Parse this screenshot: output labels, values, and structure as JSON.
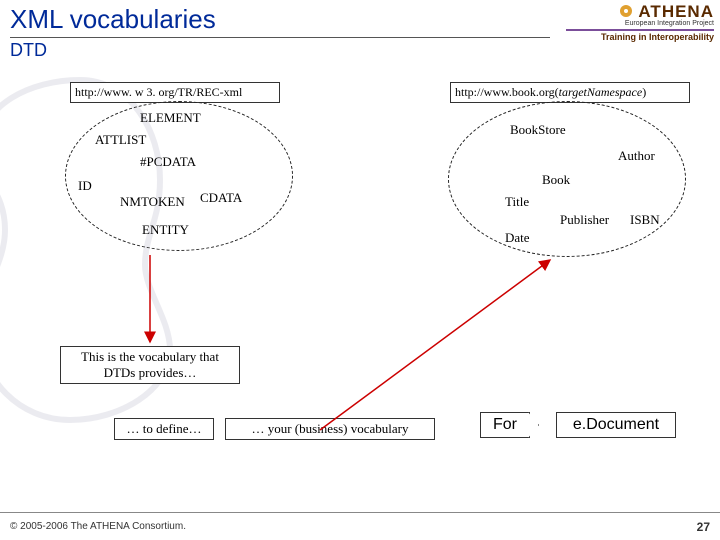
{
  "header": {
    "title": "XML vocabularies",
    "subtitle": "DTD"
  },
  "logo": {
    "brand": "ATHENA",
    "subtext": "European Integration Project",
    "tagline": "Training in Interoperability"
  },
  "urls": {
    "left": "http://www. w 3. org/TR/REC-xml",
    "right_plain": "http://www.book.org(",
    "right_italic": "targetNamespace",
    "right_close": ")"
  },
  "left_ellipse_terms": [
    "ELEMENT",
    "ATTLIST",
    "#PCDATA",
    "ID",
    "NMTOKEN",
    "CDATA",
    "ENTITY"
  ],
  "right_ellipse_terms": [
    "BookStore",
    "Author",
    "Book",
    "Title",
    "Publisher",
    "ISBN",
    "Date"
  ],
  "captions": {
    "dtd_vocab_1": "This is the vocabulary that",
    "dtd_vocab_2": "DTDs provides…",
    "to_define": "… to define…",
    "business_vocab": "… your (business) vocabulary"
  },
  "tags": {
    "for": "For",
    "edoc": "e.Document"
  },
  "footer": {
    "copyright": "© 2005-2006 The ATHENA Consortium.",
    "page": "27"
  }
}
